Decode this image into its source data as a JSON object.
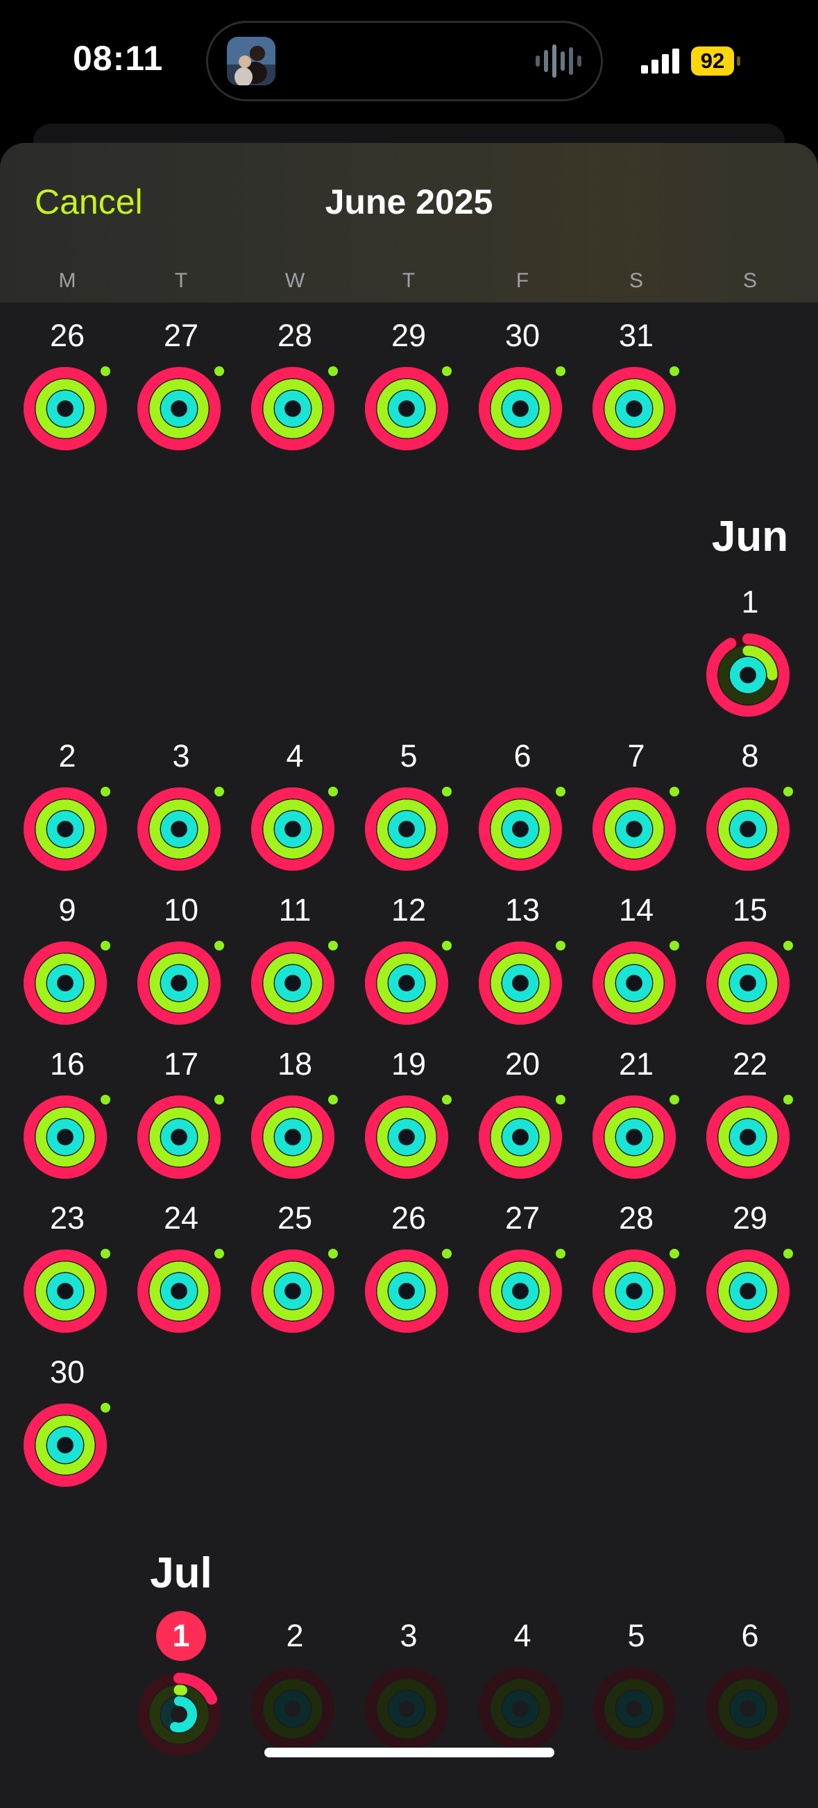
{
  "status": {
    "time": "08:11",
    "battery": "92"
  },
  "header": {
    "cancel_label": "Cancel",
    "title": "June 2025",
    "weekdays": [
      "M",
      "T",
      "W",
      "T",
      "F",
      "S",
      "S"
    ]
  },
  "colors": {
    "accent": "#c6f31b",
    "move_ring": "#ff1f5a",
    "exercise_ring": "#a2f21c",
    "stand_ring": "#19e5d6",
    "today_badge": "#ff2d55"
  },
  "calendar": {
    "may_days": [
      "26",
      "27",
      "28",
      "29",
      "30",
      "31"
    ],
    "jun_label": "Jun",
    "jun_days": [
      "1",
      "2",
      "3",
      "4",
      "5",
      "6",
      "7",
      "8",
      "9",
      "10",
      "11",
      "12",
      "13",
      "14",
      "15",
      "16",
      "17",
      "18",
      "19",
      "20",
      "21",
      "22",
      "23",
      "24",
      "25",
      "26",
      "27",
      "28",
      "29",
      "30"
    ],
    "jul_label": "Jul",
    "jul_days": [
      "1",
      "2",
      "3",
      "4",
      "5",
      "6"
    ],
    "today": "1"
  }
}
